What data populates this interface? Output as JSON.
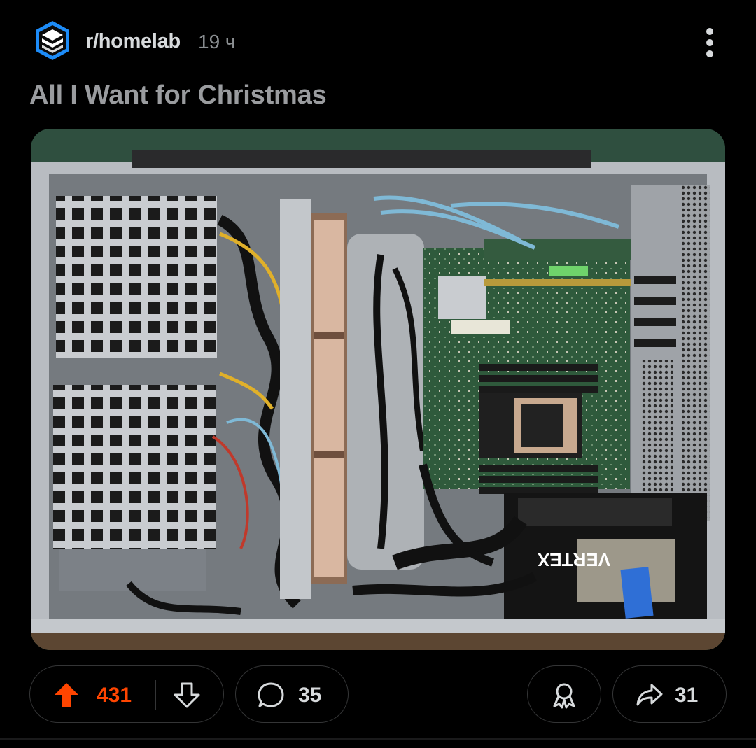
{
  "post": {
    "subreddit": "r/homelab",
    "age": "19 ч",
    "title": "All I Want for Christmas",
    "image_alt": "Server chassis interior with motherboard, fans, drive cages and power supply"
  },
  "photo_labels": {
    "psu_brand": "VERTEX"
  },
  "actions": {
    "upvotes": "431",
    "comments": "35",
    "shares": "31"
  },
  "colors": {
    "background": "#000000",
    "upvote_active": "#ff4500",
    "subreddit_icon_blue": "#1d8cf8",
    "pill_border": "#343536"
  },
  "icons": [
    "subreddit-icon",
    "more-icon",
    "upvote-icon",
    "downvote-icon",
    "comment-icon",
    "award-icon",
    "share-icon"
  ]
}
